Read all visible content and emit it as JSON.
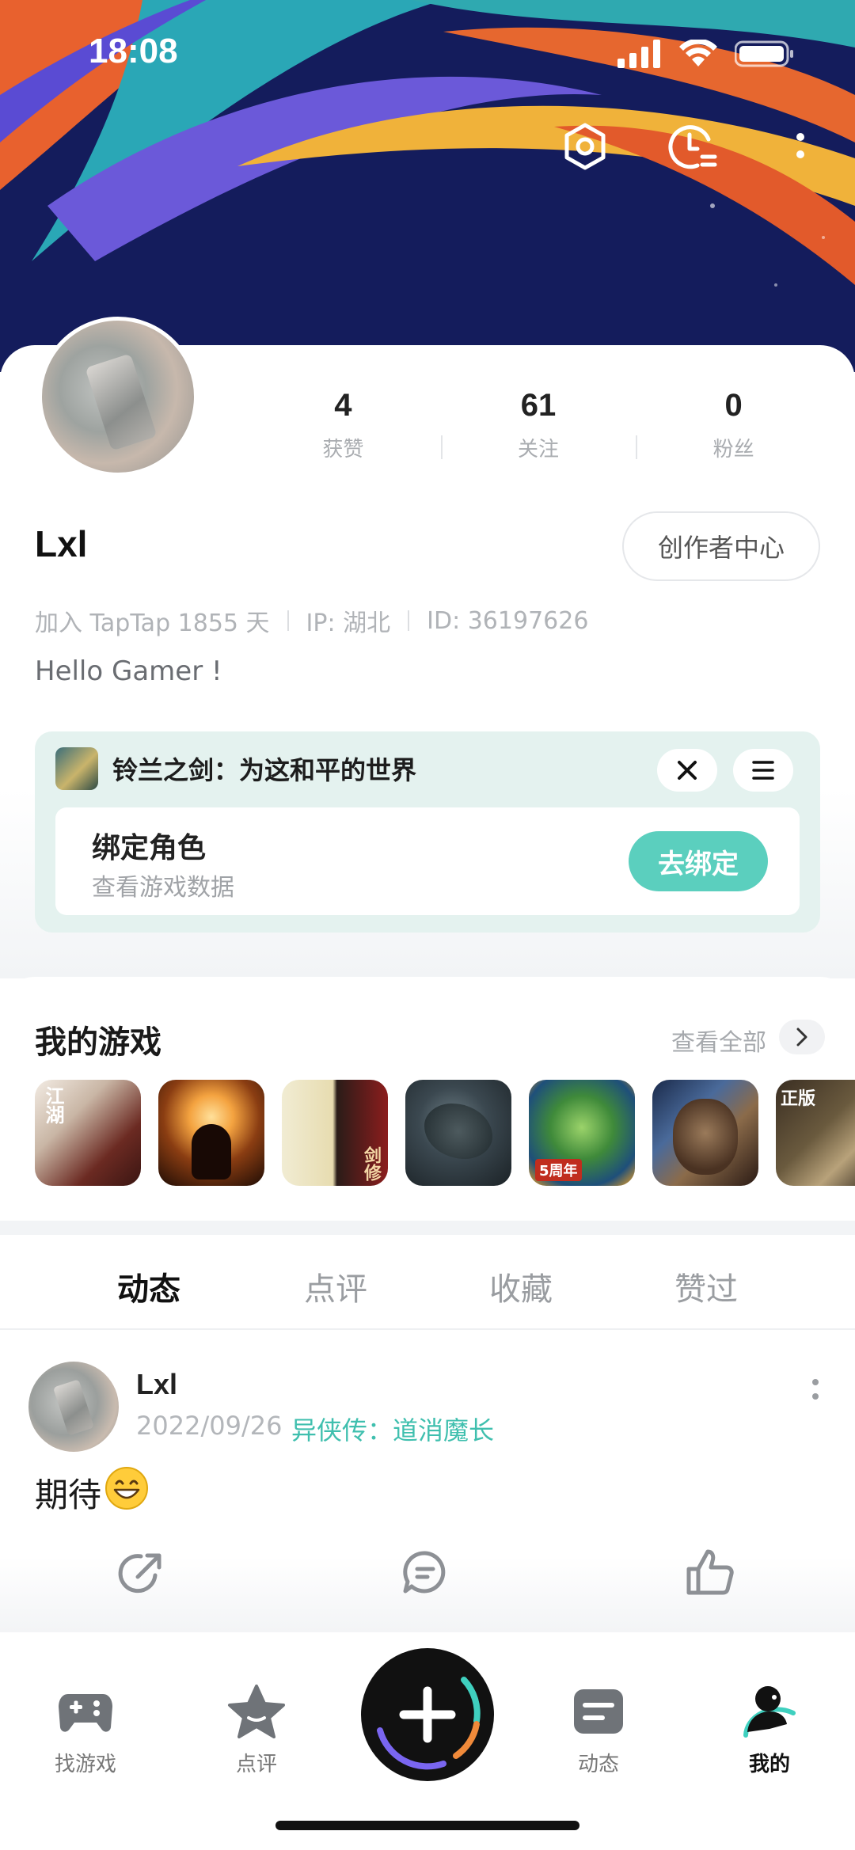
{
  "status_bar": {
    "time": "18:08"
  },
  "profile": {
    "username": "Lxl",
    "creator_center_label": "创作者中心",
    "stats": [
      {
        "value": "4",
        "label": "获赞"
      },
      {
        "value": "61",
        "label": "关注"
      },
      {
        "value": "0",
        "label": "粉丝"
      }
    ],
    "meta": {
      "joined": "加入 TapTap 1855 天",
      "ip": "IP: 湖北",
      "id": "ID: 36197626"
    },
    "bio": "Hello Gamer !"
  },
  "bind_card": {
    "game_title": "铃兰之剑：为这和平的世界",
    "heading": "绑定角色",
    "subheading": "查看游戏数据",
    "button_label": "去绑定"
  },
  "my_games": {
    "title": "我的游戏",
    "see_all_label": "查看全部",
    "tiles": [
      {
        "name": "jianghu",
        "caption": "江湖"
      },
      {
        "name": "meditating-monk",
        "caption": ""
      },
      {
        "name": "sword-cultivation",
        "caption": "剑修"
      },
      {
        "name": "dark-dragon",
        "caption": ""
      },
      {
        "name": "dragon-5th-anniversary",
        "caption": "5周年"
      },
      {
        "name": "lion-warrior",
        "caption": ""
      },
      {
        "name": "dont-starve",
        "caption": "正版"
      }
    ]
  },
  "tabs": [
    {
      "label": "动态",
      "active": true
    },
    {
      "label": "点评",
      "active": false
    },
    {
      "label": "收藏",
      "active": false
    },
    {
      "label": "赞过",
      "active": false
    }
  ],
  "post": {
    "user": "Lxl",
    "date": "2022/09/26",
    "game_tag": "异侠传：道消魔长",
    "text": "期待",
    "emoji": "😄"
  },
  "bottom_nav": [
    {
      "label": "找游戏",
      "icon": "gamepad-icon",
      "active": false
    },
    {
      "label": "点评",
      "icon": "star-icon",
      "active": false
    },
    {
      "label": "",
      "icon": "plus-icon",
      "active": false
    },
    {
      "label": "动态",
      "icon": "feed-icon",
      "active": false
    },
    {
      "label": "我的",
      "icon": "profile-icon",
      "active": true
    }
  ],
  "colors": {
    "accent": "#5bcfbe",
    "accent_text": "#3fbfae",
    "banner_bg": "#131b5a"
  }
}
